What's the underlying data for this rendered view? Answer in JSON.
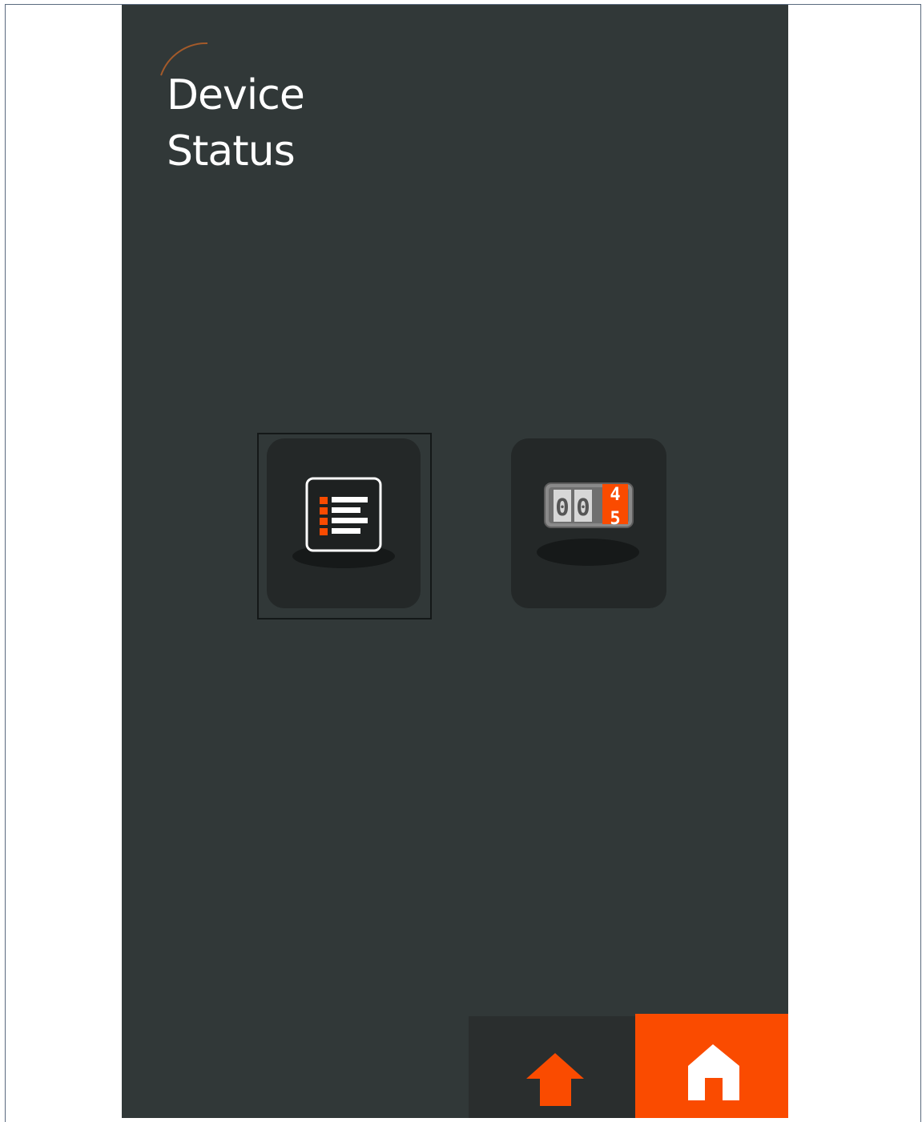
{
  "title": {
    "line1": "Device",
    "line2": "Status"
  },
  "tiles": [
    {
      "icon": "log-list-icon"
    },
    {
      "icon": "counter-icon",
      "counter_digits": [
        "0",
        "0",
        "4",
        "5"
      ]
    }
  ],
  "nav": {
    "up_icon": "up-arrow-icon",
    "home_icon": "home-icon"
  },
  "colors": {
    "background": "#313838",
    "tile": "#242828",
    "accent": "#fa4b00",
    "text": "#ffffff"
  }
}
